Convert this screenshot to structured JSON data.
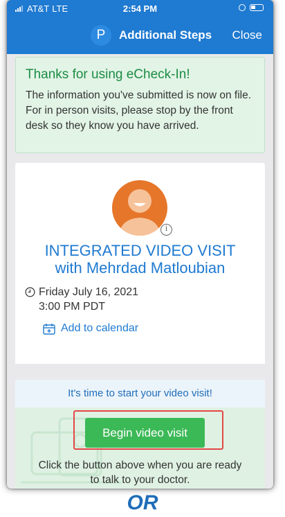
{
  "status_bar": {
    "carrier": "AT&T",
    "network": "LTE",
    "time": "2:54 PM"
  },
  "nav": {
    "app_badge": "P",
    "title": "Additional Steps",
    "close_label": "Close"
  },
  "thanks": {
    "title": "Thanks for using eCheck-In!",
    "body": "The information you've submitted is now on file. For in person visits, please stop by the front desk so they know you have arrived."
  },
  "visit": {
    "title_line1": "INTEGRATED VIDEO VISIT",
    "title_line2": "with Mehrdad Matloubian",
    "date": "Friday July 16, 2021",
    "time": "3:00 PM PDT",
    "add_to_calendar": "Add to calendar",
    "info_badge": "i"
  },
  "banner": {
    "text": "It's time to start your video visit!"
  },
  "action": {
    "button_label": "Begin video visit",
    "helper_line1": "Click the button above when you are ready",
    "helper_line2": "to talk to your doctor."
  },
  "caption": {
    "text": "OR"
  },
  "colors": {
    "brand_blue": "#1f7ad1",
    "success_green": "#3cb957",
    "highlight_red": "#e34646",
    "avatar_orange": "#e6762a"
  },
  "icons": [
    "signal-icon",
    "location-icon",
    "battery-icon",
    "clock-icon",
    "calendar-icon",
    "info-icon"
  ]
}
